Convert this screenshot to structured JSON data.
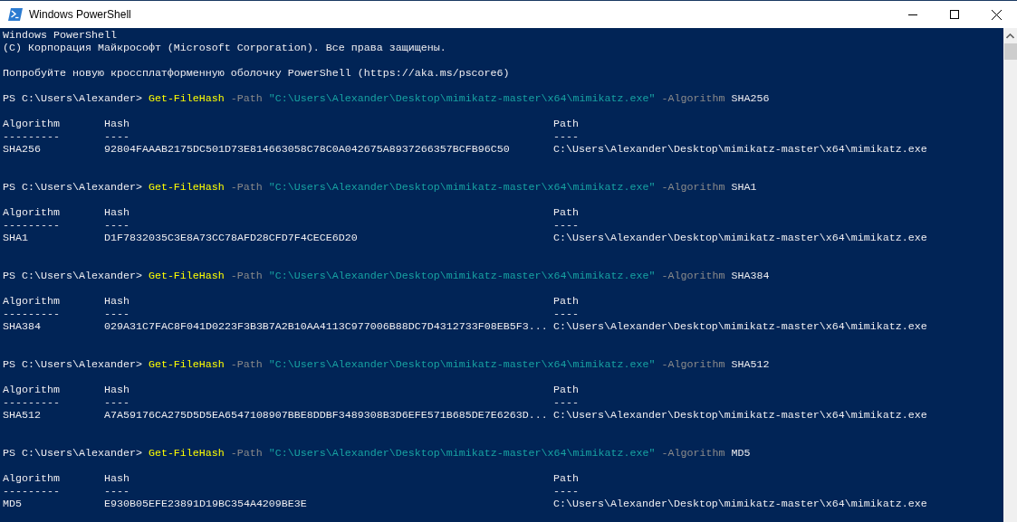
{
  "window": {
    "title": "Windows PowerShell"
  },
  "console": {
    "banner": [
      "Windows PowerShell",
      "(C) Корпорация Майкрософт (Microsoft Corporation). Все права защищены."
    ],
    "notice": "Попробуйте новую кроссплатформенную оболочку PowerShell (https://aka.ms/pscore6)",
    "commands": [
      {
        "prompt": "PS C:\\Users\\Alexander>",
        "cmdlet": "Get-FileHash",
        "path_param": "-Path",
        "path_value": "\"C:\\Users\\Alexander\\Desktop\\mimikatz-master\\x64\\mimikatz.exe\"",
        "alg_param": "-Algorithm",
        "alg_value": "SHA256",
        "columns": [
          {
            "header": "Algorithm",
            "rule": "---------"
          },
          {
            "header": "Hash",
            "rule": "----"
          },
          {
            "header": "Path",
            "rule": "----"
          }
        ],
        "row": [
          "SHA256",
          "92804FAAAB2175DC501D73E814663058C78C0A042675A8937266357BCFB96C50",
          "C:\\Users\\Alexander\\Desktop\\mimikatz-master\\x64\\mimikatz.exe"
        ]
      },
      {
        "prompt": "PS C:\\Users\\Alexander>",
        "cmdlet": "Get-FileHash",
        "path_param": "-Path",
        "path_value": "\"C:\\Users\\Alexander\\Desktop\\mimikatz-master\\x64\\mimikatz.exe\"",
        "alg_param": "-Algorithm",
        "alg_value": "SHA1",
        "columns": [
          {
            "header": "Algorithm",
            "rule": "---------"
          },
          {
            "header": "Hash",
            "rule": "----"
          },
          {
            "header": "Path",
            "rule": "----"
          }
        ],
        "row": [
          "SHA1",
          "D1F7832035C3E8A73CC78AFD28CFD7F4CECE6D20",
          "C:\\Users\\Alexander\\Desktop\\mimikatz-master\\x64\\mimikatz.exe"
        ]
      },
      {
        "prompt": "PS C:\\Users\\Alexander>",
        "cmdlet": "Get-FileHash",
        "path_param": "-Path",
        "path_value": "\"C:\\Users\\Alexander\\Desktop\\mimikatz-master\\x64\\mimikatz.exe\"",
        "alg_param": "-Algorithm",
        "alg_value": "SHA384",
        "columns": [
          {
            "header": "Algorithm",
            "rule": "---------"
          },
          {
            "header": "Hash",
            "rule": "----"
          },
          {
            "header": "Path",
            "rule": "----"
          }
        ],
        "row": [
          "SHA384",
          "029A31C7FAC8F041D0223F3B3B7A2B10AA4113C977006B88DC7D4312733F08EB5F3...",
          "C:\\Users\\Alexander\\Desktop\\mimikatz-master\\x64\\mimikatz.exe"
        ]
      },
      {
        "prompt": "PS C:\\Users\\Alexander>",
        "cmdlet": "Get-FileHash",
        "path_param": "-Path",
        "path_value": "\"C:\\Users\\Alexander\\Desktop\\mimikatz-master\\x64\\mimikatz.exe\"",
        "alg_param": "-Algorithm",
        "alg_value": "SHA512",
        "columns": [
          {
            "header": "Algorithm",
            "rule": "---------"
          },
          {
            "header": "Hash",
            "rule": "----"
          },
          {
            "header": "Path",
            "rule": "----"
          }
        ],
        "row": [
          "SHA512",
          "A7A59176CA275D5D5EA6547108907BBE8DDBF3489308B3D6EFE571B685DE7E6263D...",
          "C:\\Users\\Alexander\\Desktop\\mimikatz-master\\x64\\mimikatz.exe"
        ]
      },
      {
        "prompt": "PS C:\\Users\\Alexander>",
        "cmdlet": "Get-FileHash",
        "path_param": "-Path",
        "path_value": "\"C:\\Users\\Alexander\\Desktop\\mimikatz-master\\x64\\mimikatz.exe\"",
        "alg_param": "-Algorithm",
        "alg_value": "MD5",
        "columns": [
          {
            "header": "Algorithm",
            "rule": "---------"
          },
          {
            "header": "Hash",
            "rule": "----"
          },
          {
            "header": "Path",
            "rule": "----"
          }
        ],
        "row": [
          "MD5",
          "E930B05EFE23891D19BC354A4209BE3E",
          "C:\\Users\\Alexander\\Desktop\\mimikatz-master\\x64\\mimikatz.exe"
        ]
      }
    ]
  }
}
